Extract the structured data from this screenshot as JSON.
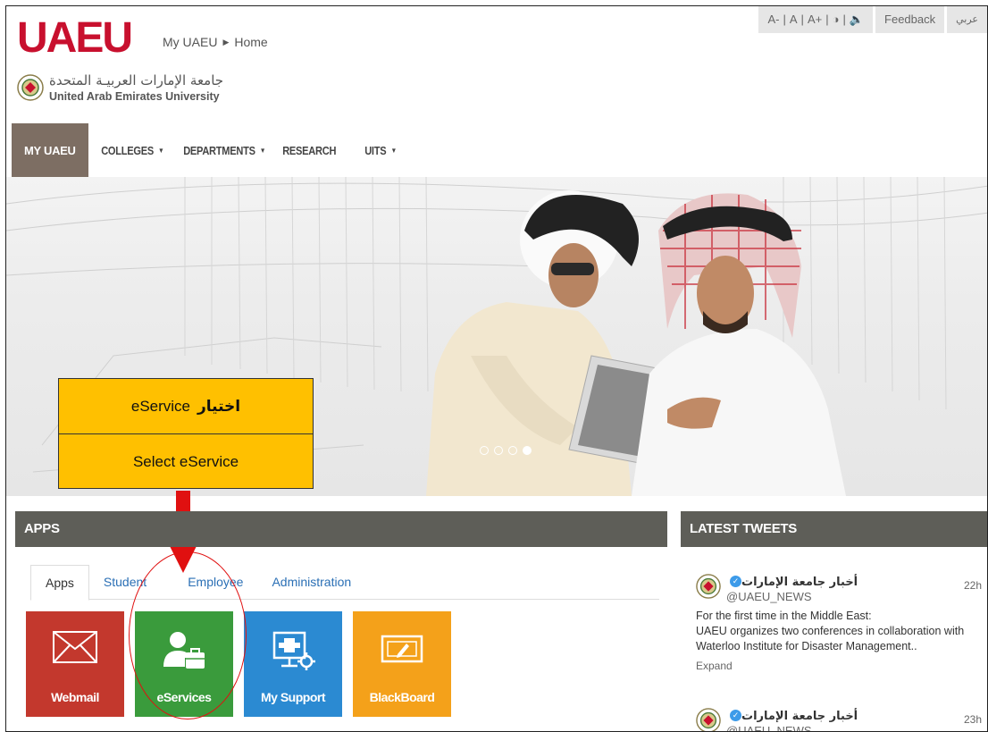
{
  "header": {
    "logo": "UAEU",
    "breadcrumb": [
      "My UAEU",
      "Home"
    ],
    "university_ar": "جامعة الإمارات العربيـة المتحدة",
    "university_en": "United Arab Emirates University",
    "text_size": [
      "A-",
      "A",
      "A+"
    ],
    "feedback": "Feedback",
    "language": "عربي"
  },
  "nav": {
    "items": [
      {
        "label": "MY UAEU",
        "has_menu": false
      },
      {
        "label": "COLLEGES",
        "has_menu": true
      },
      {
        "label": "DEPARTMENTS",
        "has_menu": true
      },
      {
        "label": "RESEARCH",
        "has_menu": false
      },
      {
        "label": "UITS",
        "has_menu": true
      }
    ],
    "active_index": 0
  },
  "hero": {
    "slide_count": 4,
    "active_slide": 3
  },
  "callout": {
    "line1_ar": "اختيار",
    "line1_en": "eService",
    "line2": "Select eService"
  },
  "apps": {
    "title": "APPS",
    "tabs": [
      "Apps",
      "Student",
      "Employee",
      "Administration"
    ],
    "active_tab": 0,
    "tiles": [
      {
        "label": "Webmail",
        "icon": "envelope-icon",
        "color": "#c3382d"
      },
      {
        "label": "eServices",
        "icon": "user-briefcase-icon",
        "color": "#3a9b3c"
      },
      {
        "label": "My Support",
        "icon": "support-monitor-icon",
        "color": "#2b8ad2"
      },
      {
        "label": "BlackBoard",
        "icon": "board-pencil-icon",
        "color": "#f4a11a"
      }
    ]
  },
  "tweets": {
    "title": "LATEST TWEETS",
    "items": [
      {
        "name": "أخبار جامعة الإمارات",
        "handle": "@UAEU_NEWS",
        "time": "22h",
        "text": "For the first time in the Middle East:\nUAEU organizes two conferences in collaboration with Waterloo Institute for Disaster Management..",
        "expand": "Expand"
      },
      {
        "name": "أخبار جامعة الإمارات",
        "handle": "@UAEU_NEWS",
        "time": "23h"
      }
    ]
  },
  "colors": {
    "brand_red": "#c8102e",
    "nav_active": "#7d6e63",
    "panel_header": "#5e5e58",
    "callout": "#ffc000",
    "annotation_red": "#e01010"
  }
}
